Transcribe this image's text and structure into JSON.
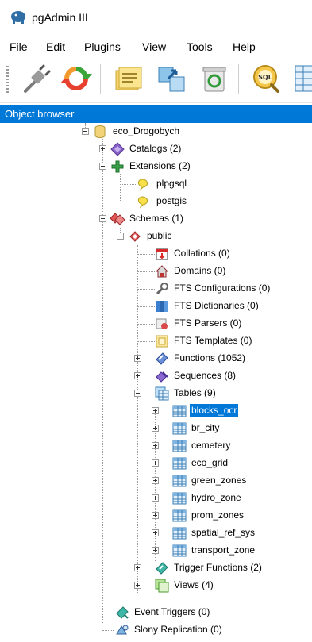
{
  "app": {
    "title": "pgAdmin III"
  },
  "menu": [
    "File",
    "Edit",
    "Plugins",
    "View",
    "Tools",
    "Help"
  ],
  "toolbar": {
    "buttons": [
      "connect-icon",
      "refresh-icon",
      "properties-icon",
      "create-object-icon",
      "delete-icon",
      "sql-query-icon",
      "view-data-icon"
    ],
    "sql_label": "SQL"
  },
  "object_browser": {
    "title": "Object browser",
    "db": "eco_Drogobych",
    "catalogs": "Catalogs (2)",
    "extensions": "Extensions (2)",
    "ext_items": [
      "plpgsql",
      "postgis"
    ],
    "schemas": "Schemas (1)",
    "public": "public",
    "public_items": [
      "Collations (0)",
      "Domains (0)",
      "FTS Configurations (0)",
      "FTS Dictionaries (0)",
      "FTS Parsers (0)",
      "FTS Templates (0)",
      "Functions (1052)",
      "Sequences (8)"
    ],
    "tables": "Tables (9)",
    "table_items": [
      "blocks_ocr",
      "br_city",
      "cemetery",
      "eco_grid",
      "green_zones",
      "hydro_zone",
      "prom_zones",
      "spatial_ref_sys",
      "transport_zone"
    ],
    "selected_table": "blocks_ocr",
    "trigger_functions": "Trigger Functions (2)",
    "views": "Views (4)",
    "event_triggers": "Event Triggers (0)",
    "slony": "Slony Replication (0)"
  },
  "colors": {
    "selection": "#0078d7"
  }
}
